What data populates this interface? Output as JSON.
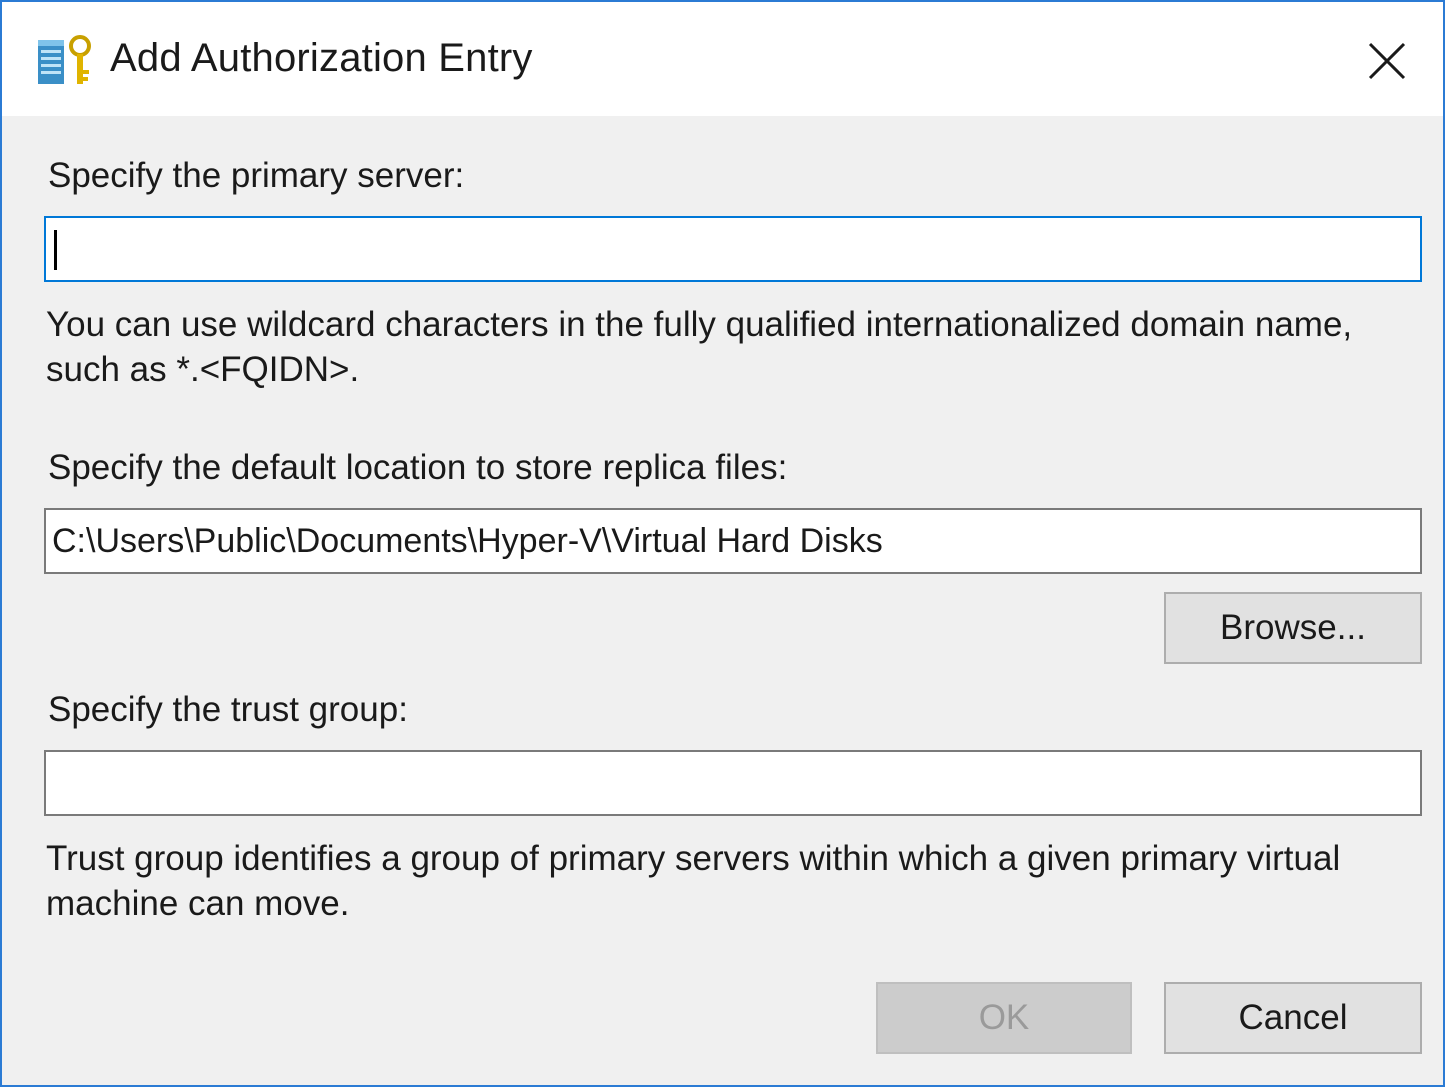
{
  "window": {
    "title": "Add Authorization Entry",
    "icon": "server-key-icon",
    "close_icon": "close-icon",
    "accent_border_color": "#2b7bd4"
  },
  "primary_server": {
    "label": "Specify the primary server:",
    "value": "",
    "hint": "You can use wildcard characters in  the fully qualified internationalized domain name, such as *.<FQIDN>."
  },
  "replica_location": {
    "label": "Specify the default location to store replica files:",
    "value": "C:\\Users\\Public\\Documents\\Hyper-V\\Virtual Hard Disks",
    "browse_label": "Browse..."
  },
  "trust_group": {
    "label": "Specify the trust group:",
    "value": "",
    "hint": "Trust group identifies a group of primary servers within which a given primary virtual machine can move."
  },
  "footer": {
    "ok_label": "OK",
    "ok_enabled": false,
    "cancel_label": "Cancel"
  }
}
